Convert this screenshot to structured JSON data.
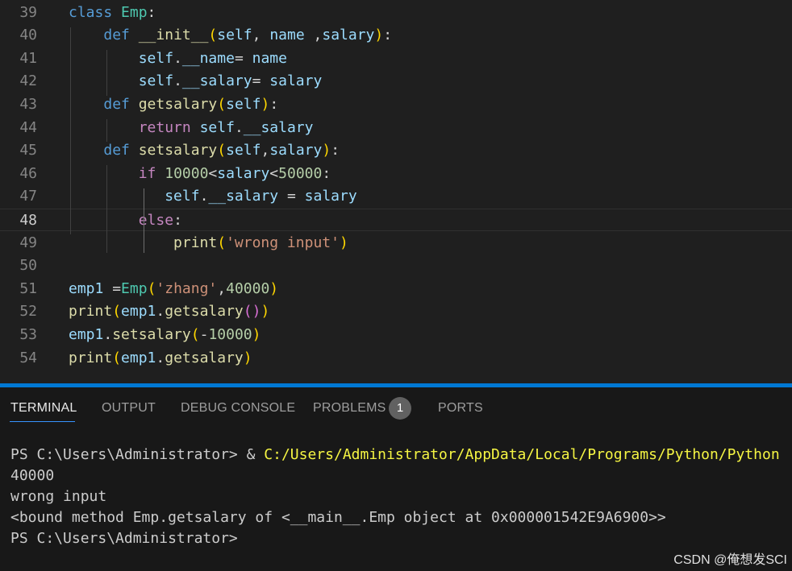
{
  "editor": {
    "current_line": "48",
    "lines": [
      {
        "num": "39",
        "tokens": [
          [
            "class",
            "kw"
          ],
          [
            " ",
            "op"
          ],
          [
            "Emp",
            "cls"
          ],
          [
            ":",
            "op"
          ]
        ]
      },
      {
        "num": "40",
        "tokens": [
          [
            "    ",
            "op"
          ],
          [
            "def",
            "kw"
          ],
          [
            " ",
            "op"
          ],
          [
            "__init__",
            "fn"
          ],
          [
            "(",
            "b1"
          ],
          [
            "self",
            "var"
          ],
          [
            ", ",
            "op"
          ],
          [
            "name",
            "var"
          ],
          [
            " ,",
            "op"
          ],
          [
            "salary",
            "var"
          ],
          [
            ")",
            "b1"
          ],
          [
            ":",
            "op"
          ]
        ]
      },
      {
        "num": "41",
        "tokens": [
          [
            "        ",
            "op"
          ],
          [
            "self",
            "var"
          ],
          [
            ".",
            "op"
          ],
          [
            "__name",
            "var"
          ],
          [
            "= ",
            "op"
          ],
          [
            "name",
            "var"
          ]
        ]
      },
      {
        "num": "42",
        "tokens": [
          [
            "        ",
            "op"
          ],
          [
            "self",
            "var"
          ],
          [
            ".",
            "op"
          ],
          [
            "__salary",
            "var"
          ],
          [
            "= ",
            "op"
          ],
          [
            "salary",
            "var"
          ]
        ]
      },
      {
        "num": "43",
        "tokens": [
          [
            "    ",
            "op"
          ],
          [
            "def",
            "kw"
          ],
          [
            " ",
            "op"
          ],
          [
            "getsalary",
            "fn"
          ],
          [
            "(",
            "b1"
          ],
          [
            "self",
            "var"
          ],
          [
            ")",
            "b1"
          ],
          [
            ":",
            "op"
          ]
        ]
      },
      {
        "num": "44",
        "tokens": [
          [
            "        ",
            "op"
          ],
          [
            "return",
            "ctl"
          ],
          [
            " ",
            "op"
          ],
          [
            "self",
            "var"
          ],
          [
            ".",
            "op"
          ],
          [
            "__salary",
            "var"
          ]
        ]
      },
      {
        "num": "45",
        "tokens": [
          [
            "    ",
            "op"
          ],
          [
            "def",
            "kw"
          ],
          [
            " ",
            "op"
          ],
          [
            "setsalary",
            "fn"
          ],
          [
            "(",
            "b1"
          ],
          [
            "self",
            "var"
          ],
          [
            ",",
            "op"
          ],
          [
            "salary",
            "var"
          ],
          [
            ")",
            "b1"
          ],
          [
            ":",
            "op"
          ]
        ]
      },
      {
        "num": "46",
        "tokens": [
          [
            "        ",
            "op"
          ],
          [
            "if",
            "ctl"
          ],
          [
            " ",
            "op"
          ],
          [
            "10000",
            "num"
          ],
          [
            "<",
            "op"
          ],
          [
            "salary",
            "var"
          ],
          [
            "<",
            "op"
          ],
          [
            "50000",
            "num"
          ],
          [
            ":",
            "op"
          ]
        ]
      },
      {
        "num": "47",
        "tokens": [
          [
            "           ",
            "op"
          ],
          [
            "self",
            "var"
          ],
          [
            ".",
            "op"
          ],
          [
            "__salary",
            "var"
          ],
          [
            " = ",
            "op"
          ],
          [
            "salary",
            "var"
          ]
        ]
      },
      {
        "num": "48",
        "tokens": [
          [
            "        ",
            "op"
          ],
          [
            "else",
            "ctl"
          ],
          [
            ":",
            "op"
          ]
        ]
      },
      {
        "num": "49",
        "tokens": [
          [
            "            ",
            "op"
          ],
          [
            "print",
            "fn"
          ],
          [
            "(",
            "b1"
          ],
          [
            "'wrong input'",
            "str"
          ],
          [
            ")",
            "b1"
          ]
        ]
      },
      {
        "num": "50",
        "tokens": []
      },
      {
        "num": "51",
        "tokens": [
          [
            "emp1",
            "var"
          ],
          [
            " =",
            "op"
          ],
          [
            "Emp",
            "cls"
          ],
          [
            "(",
            "b1"
          ],
          [
            "'zhang'",
            "str"
          ],
          [
            ",",
            "op"
          ],
          [
            "40000",
            "num"
          ],
          [
            ")",
            "b1"
          ]
        ]
      },
      {
        "num": "52",
        "tokens": [
          [
            "print",
            "fn"
          ],
          [
            "(",
            "b1"
          ],
          [
            "emp1",
            "var"
          ],
          [
            ".",
            "op"
          ],
          [
            "getsalary",
            "fn"
          ],
          [
            "(",
            "b2"
          ],
          [
            ")",
            "b2"
          ],
          [
            ")",
            "b1"
          ]
        ]
      },
      {
        "num": "53",
        "tokens": [
          [
            "emp1",
            "var"
          ],
          [
            ".",
            "op"
          ],
          [
            "setsalary",
            "fn"
          ],
          [
            "(",
            "b1"
          ],
          [
            "-",
            "op"
          ],
          [
            "10000",
            "num"
          ],
          [
            ")",
            "b1"
          ]
        ]
      },
      {
        "num": "54",
        "tokens": [
          [
            "print",
            "fn"
          ],
          [
            "(",
            "b1"
          ],
          [
            "emp1",
            "var"
          ],
          [
            ".",
            "op"
          ],
          [
            "getsalary",
            "fn"
          ],
          [
            ")",
            "b1"
          ]
        ]
      }
    ]
  },
  "panel": {
    "tabs": {
      "terminal": "TERMINAL",
      "output": "OUTPUT",
      "debug_console": "DEBUG CONSOLE",
      "problems": "PROBLEMS",
      "ports": "PORTS"
    },
    "problems_count": "1",
    "terminal": {
      "prompt1": "PS C:\\Users\\Administrator> & ",
      "command_path": "C:/Users/Administrator/AppData/Local/Programs/Python/Python",
      "out1": "40000",
      "out2": "wrong input",
      "out3": "<bound method Emp.getsalary of <__main__.Emp object at 0x000001542E9A6900>>",
      "prompt2": "PS C:\\Users\\Administrator>"
    }
  },
  "watermark": "CSDN @俺想发SCI",
  "colors": {
    "keyword": "#569cd6",
    "class": "#4ec9b0",
    "function": "#dcdcaa",
    "variable": "#9cdcfe",
    "control": "#c586c0",
    "number": "#b5cea8",
    "string": "#ce9178",
    "bracket_level1": "#ffd700",
    "bracket_level2": "#da70d6",
    "accent": "#0078d4"
  }
}
